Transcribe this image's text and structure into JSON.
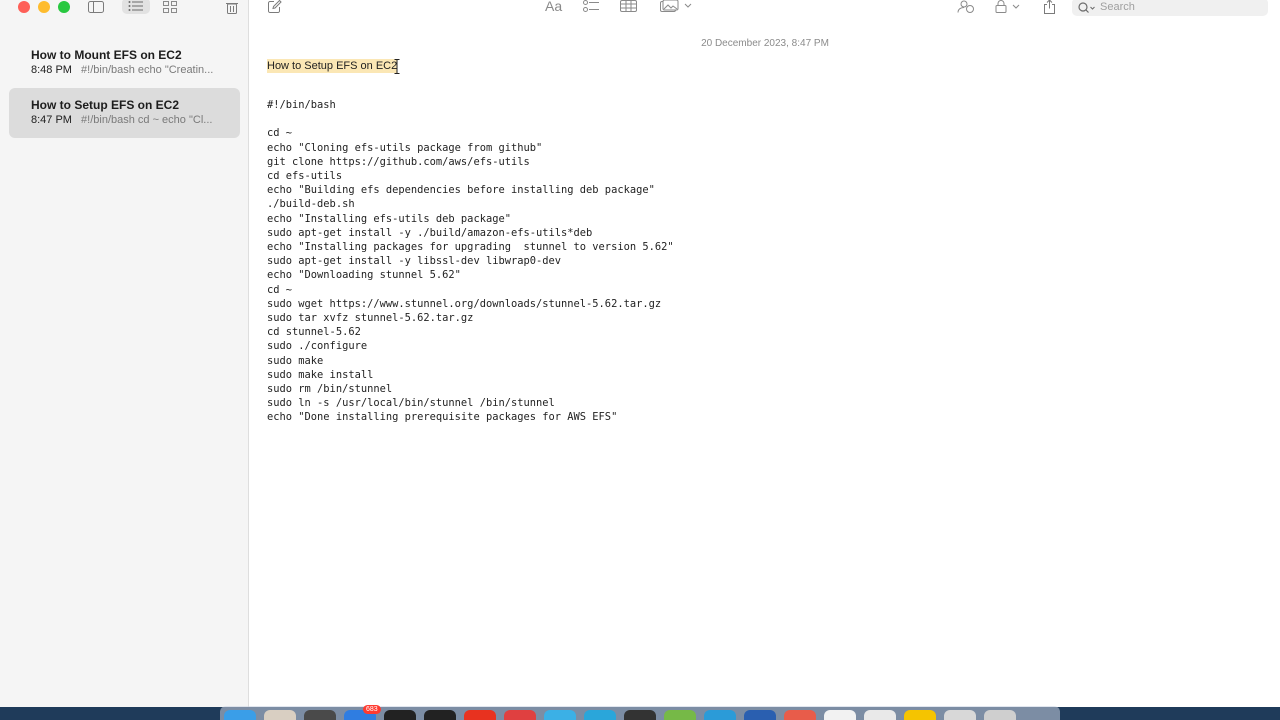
{
  "colors": {
    "selection_highlight": "#fbe7b5",
    "selected_note_bg": "#dcdcdc",
    "sidebar_bg": "#f5f5f5",
    "traffic_red": "#fe5f57",
    "traffic_yellow": "#febc2e",
    "traffic_green": "#28c840"
  },
  "toolbar": {
    "format_label": "Aa",
    "search_placeholder": "Search"
  },
  "notes": [
    {
      "title": "How to Mount EFS on EC2",
      "time": "8:48 PM",
      "preview": "#!/bin/bash echo \"Creatin...",
      "selected": false
    },
    {
      "title": "How to Setup EFS on EC2",
      "time": "8:47 PM",
      "preview": "#!/bin/bash cd ~ echo \"Cl...",
      "selected": true
    }
  ],
  "editor": {
    "date": "20 December 2023, 8:47 PM",
    "title": "How to Setup EFS on EC2",
    "body": "#!/bin/bash\n\ncd ~\necho \"Cloning efs-utils package from github\"\ngit clone https://github.com/aws/efs-utils\ncd efs-utils\necho \"Building efs dependencies before installing deb package\"\n./build-deb.sh\necho \"Installing efs-utils deb package\"\nsudo apt-get install -y ./build/amazon-efs-utils*deb\necho \"Installing packages for upgrading  stunnel to version 5.62\"\nsudo apt-get install -y libssl-dev libwrap0-dev\necho \"Downloading stunnel 5.62\"\ncd ~\nsudo wget https://www.stunnel.org/downloads/stunnel-5.62.tar.gz\nsudo tar xvfz stunnel-5.62.tar.gz\ncd stunnel-5.62\nsudo ./configure\nsudo make\nsudo make install\nsudo rm /bin/stunnel\nsudo ln -s /usr/local/bin/stunnel /bin/stunnel\necho \"Done installing prerequisite packages for AWS EFS\""
  },
  "dock": {
    "badge": "683"
  }
}
